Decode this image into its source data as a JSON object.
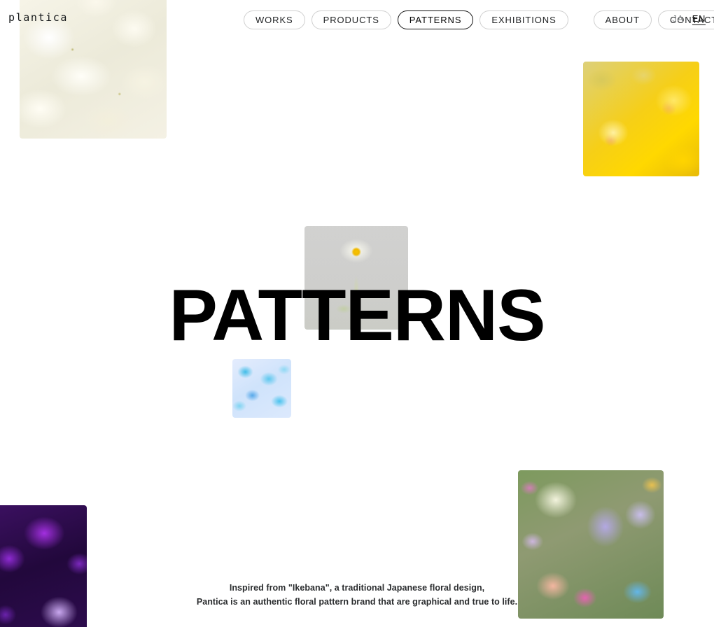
{
  "site": {
    "logo": "plantica",
    "background_color": "#ffffff"
  },
  "nav": {
    "items": [
      {
        "label": "WORKS",
        "active": false
      },
      {
        "label": "PRODUCTS",
        "active": false
      },
      {
        "label": "PATTERNS",
        "active": true
      },
      {
        "label": "EXHIBITIONS",
        "active": false
      },
      {
        "label": "ABOUT",
        "active": false
      },
      {
        "label": "CONTACT",
        "active": false
      }
    ],
    "active_color": "#111111",
    "idle_border_color": "#cfcfcf"
  },
  "language": {
    "options": [
      {
        "label": "JA",
        "active": false
      },
      {
        "label": "EN",
        "active": true
      }
    ]
  },
  "hero": {
    "title": "PATTERNS"
  },
  "tagline": {
    "line1": "Inspired from \"Ikebana\", a traditional Japanese floral design,",
    "line2": "Pantica is an authentic floral pattern brand that are graphical and true to life."
  },
  "gallery": {
    "images": [
      {
        "name": "white-flowers",
        "alt": "white hydrangea and chrysanthemum close-up",
        "accent": "#f2efe1"
      },
      {
        "name": "yellow-flowers",
        "alt": "vivid yellow chrysanthemum and dahlia",
        "accent": "#f6cf17"
      },
      {
        "name": "white-daisy",
        "alt": "single white daisy with yellow centre on grey",
        "accent": "#c9c9c9"
      },
      {
        "name": "blue-pattern",
        "alt": "light blue watercolour floral pattern",
        "accent": "#5cc8ef"
      },
      {
        "name": "pastel-bouquet",
        "alt": "mixed pastel bouquet of sweet peas and roses",
        "accent": "#b3a8e2"
      },
      {
        "name": "purple-flowers",
        "alt": "deep purple flowers on dark background",
        "accent": "#a32fe0"
      }
    ]
  }
}
